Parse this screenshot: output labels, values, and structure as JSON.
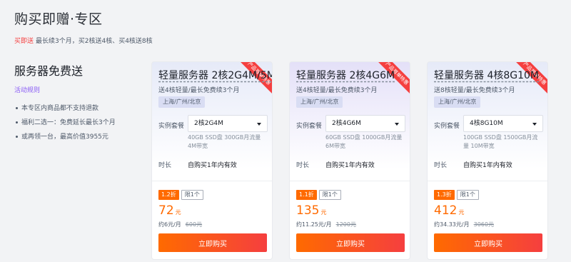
{
  "header": {
    "title": "购买即赠·专区",
    "promo_tag": "买即送",
    "promo_text": "最长续3个月，买2核送4核、买4核送8核"
  },
  "aside": {
    "title": "服务器免费送",
    "rules_link": "活动规则",
    "items": [
      "本专区内商品都不支持退款",
      "福利二选一：免费延长最长3个月",
      "或再领一台，最高价值3955元"
    ]
  },
  "labels": {
    "spec": "实例套餐",
    "duration": "时长",
    "buy": "立即购买"
  },
  "cards": [
    {
      "title": "轻量服务器 2核2G4M/5M",
      "ribbon": "产品首单特惠",
      "desc": "送4核轻量/最长免费续3个月",
      "region": "上海/广州/北京",
      "spec_value": "2核2G4M",
      "spec_note": "40GB SSD盘 300GB月流量 4M带宽",
      "duration": "自购买1年内有效",
      "discount": "1.2折",
      "limit": "限1个",
      "price": "72",
      "price_unit": "元",
      "monthly": "约6元/月",
      "original": "600元"
    },
    {
      "title": "轻量服务器 2核4G6M",
      "ribbon": "产品首单特惠",
      "desc": "送4核轻量/最长免费续3个月",
      "region": "上海/广州/北京",
      "spec_value": "2核4G6M",
      "spec_note": "60GB SSD盘 1000GB月流量 6M带宽",
      "duration": "自购买1年内有效",
      "discount": "1.1折",
      "limit": "限1个",
      "price": "135",
      "price_unit": "元",
      "monthly": "约11.25元/月",
      "original": "1200元"
    },
    {
      "title": "轻量服务器 4核8G10M",
      "ribbon": "产品首单特惠",
      "desc": "送8核轻量/最长免费续3个月",
      "region": "上海/广州/北京",
      "spec_value": "4核8G10M",
      "spec_note": "100GB SSD盘 1500GB月流量 10M带宽",
      "duration": "自购买1年内有效",
      "discount": "1.3折",
      "limit": "限1个",
      "price": "412",
      "price_unit": "元",
      "monthly": "约34.33元/月",
      "original": "3060元"
    }
  ],
  "colors": {
    "accent_orange": "#ff6a00",
    "accent_red": "#f53f3f",
    "rules_purple": "#8a5cf5"
  }
}
